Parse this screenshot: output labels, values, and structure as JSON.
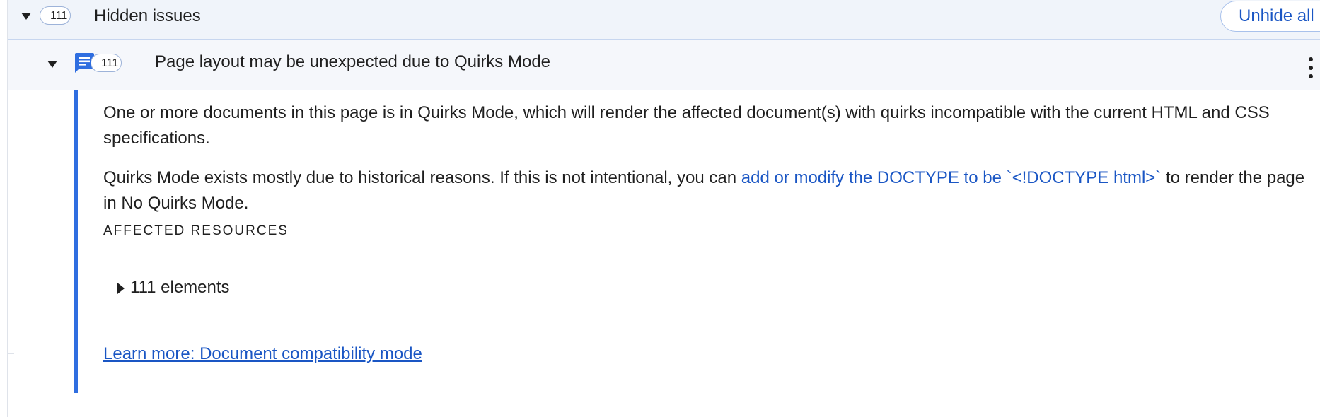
{
  "hidden_section": {
    "count": "111",
    "title": "Hidden issues",
    "unhide_label": "Unhide all"
  },
  "issue": {
    "count": "111",
    "title": "Page layout may be unexpected due to Quirks Mode",
    "icon": "issue-message-icon",
    "accent_color": "#2f6ee0"
  },
  "details": {
    "paragraph1": "One or more documents in this page is in Quirks Mode, which will render the affected document(s) with quirks incompatible with the current HTML and CSS specifications.",
    "paragraph2_before": "Quirks Mode exists mostly due to historical reasons. If this is not intentional, you can ",
    "paragraph2_link": "add or modify the DOCTYPE to be `<!DOCTYPE html>`",
    "paragraph2_after": " to render the page in No Quirks Mode.",
    "affected_heading": "AFFECTED RESOURCES",
    "elements_label": "111 elements",
    "learn_more": "Learn more: Document compatibility mode"
  },
  "colors": {
    "link": "#1a56c4",
    "header_bg": "#f0f4fa",
    "issue_bg": "#f5f7fb"
  }
}
